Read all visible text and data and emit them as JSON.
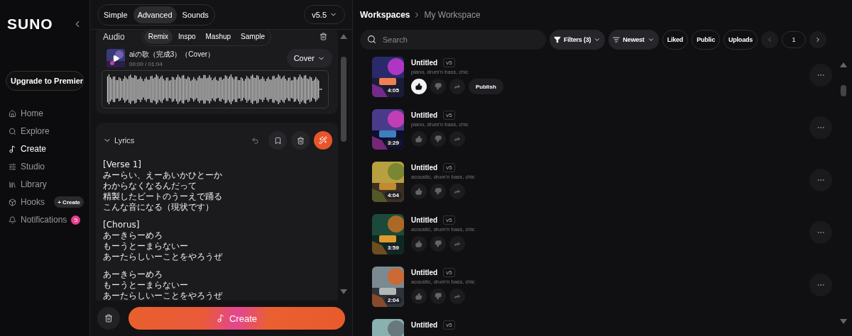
{
  "sidebar": {
    "logo": "SUNO",
    "upgrade_button": "Upgrade to Premier",
    "items": [
      {
        "label": "Home",
        "selected": false
      },
      {
        "label": "Explore",
        "selected": false
      },
      {
        "label": "Create",
        "selected": true
      },
      {
        "label": "Studio",
        "selected": false
      },
      {
        "label": "Library",
        "selected": false
      },
      {
        "label": "Hooks",
        "selected": false,
        "action": "+ Create"
      },
      {
        "label": "Notifications",
        "selected": false,
        "count": "5"
      }
    ]
  },
  "create_panel": {
    "modes": [
      {
        "label": "Simple",
        "selected": false
      },
      {
        "label": "Advanced",
        "selected": true
      },
      {
        "label": "Sounds",
        "selected": false
      }
    ],
    "version": "v5.5",
    "audio": {
      "title": "Audio",
      "tabs": [
        {
          "label": "Remix",
          "selected": true
        },
        {
          "label": "Inspo",
          "selected": false
        },
        {
          "label": "Mashup",
          "selected": false
        },
        {
          "label": "Sample",
          "selected": false
        }
      ],
      "track": {
        "title": "aiの歌（完成3）（Cover）",
        "time": "00:00 / 01:04"
      },
      "type": "Cover"
    },
    "lyrics": {
      "title": "Lyrics",
      "expanded": true,
      "stanzas": [
        [
          "[Verse 1]",
          "みーらい、えーあいかひとーか",
          "わからなくなるんだって",
          "精製したビートのうーえで踊る",
          "こんな音になる（現状です）"
        ],
        [
          "[Chorus]",
          "あーきらーめろ",
          "もーうとーまらないー",
          "あーたらしいーことをやろうぜ"
        ],
        [
          "あーきらーめろ",
          "もーうとーまらないー",
          "あーたらしいーことをやろうぜ"
        ]
      ]
    },
    "create_button": "Create"
  },
  "workspace": {
    "breadcrumb": [
      "Workspaces",
      "My Workspace"
    ],
    "search": {
      "placeholder": "Search"
    },
    "filters": "Filters (3)",
    "sort": "Newest",
    "toggles": [
      "Liked",
      "Public",
      "Uploads"
    ],
    "page": "1",
    "songs": [
      {
        "title": "Untitled",
        "version": "v5",
        "tags": "piano, drum'n bass, chic",
        "duration": "4:05",
        "liked": true,
        "publish": "Publish"
      },
      {
        "title": "Untitled",
        "version": "v5",
        "tags": "piano, drum'n bass, chic",
        "duration": "3:29",
        "liked": false
      },
      {
        "title": "Untitled",
        "version": "v5",
        "tags": "acoustic, drum'n bass, chic",
        "duration": "4:04",
        "liked": false
      },
      {
        "title": "Untitled",
        "version": "v5",
        "tags": "acoustic, drum'n bass, chic",
        "duration": "3:59",
        "liked": false
      },
      {
        "title": "Untitled",
        "version": "v5",
        "tags": "acoustic, drum'n bass, chic",
        "duration": "2:04",
        "liked": false
      },
      {
        "title": "Untitled",
        "version": "v5"
      }
    ]
  }
}
